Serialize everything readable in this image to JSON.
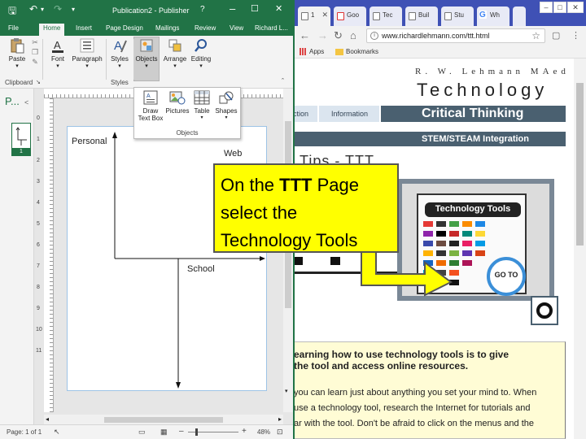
{
  "publisher": {
    "title": "Publication2 - Publisher",
    "help": "?",
    "ribbon_tabs": [
      "File",
      "Home",
      "Insert",
      "Page Design",
      "Mailings",
      "Review",
      "View",
      "Richard L..."
    ],
    "groups": {
      "paste": "Paste",
      "font": "Font",
      "paragraph": "Paragraph",
      "styles": "Styles",
      "objects": "Objects",
      "arrange": "Arrange",
      "editing": "Editing"
    },
    "group_labels": {
      "clipboard": "Clipboard",
      "styles": "Styles"
    },
    "objects_dropdown": {
      "items": [
        "Draw Text Box",
        "Pictures",
        "Table",
        "Shapes"
      ],
      "draw_line1": "Draw",
      "draw_line2": "Text Box",
      "footer": "Objects"
    },
    "pages_pane_initial": "P...",
    "page_number": "1",
    "ruler_numbers": [
      "0",
      "1",
      "2",
      "3",
      "4",
      "5",
      "6",
      "7",
      "8",
      "9",
      "10",
      "11"
    ],
    "canvas_labels": {
      "personal": "Personal",
      "web": "Web",
      "school": "School"
    },
    "status": {
      "page": "Page: 1 of 1",
      "zoom": "48%"
    }
  },
  "chrome": {
    "tabs": [
      "1",
      "Goo",
      "Tec",
      "Buil",
      "Stu",
      "Wh"
    ],
    "url": "www.richardlehmann.com/ttt.html",
    "bookmarks": [
      "Apps",
      "Bookmarks"
    ],
    "site": {
      "name": "R. W. Lehmann MAed",
      "heading": "Technology",
      "nav_partial": "ction",
      "nav_info": "Information",
      "banner": "Critical Thinking",
      "subbanner": "STEM/STEAM Integration",
      "tips_heading": "Tips - TTT",
      "tt_card_title": "Technology Tools",
      "goto": "GO TO",
      "panel_lines": [
        "earning how to use technology tools is to give",
        "the tool and access online resources.",
        "you can learn just about anything you set your mind to. When",
        "use a technology tool, research the Internet for tutorials and",
        "ar with the tool. Don't be afraid to click on the menus and the"
      ]
    }
  },
  "callout": {
    "pre": "On the ",
    "bold": "TTT",
    "post": " Page",
    "line2": "select the",
    "line3": "Technology Tools"
  },
  "colors": {
    "publisher_green": "#217346",
    "callout_yellow": "#ffff00",
    "banner_slate": "#4a6070",
    "goto_blue": "#3b8fd8",
    "chrome_tabstrip": "#3f51b5"
  }
}
